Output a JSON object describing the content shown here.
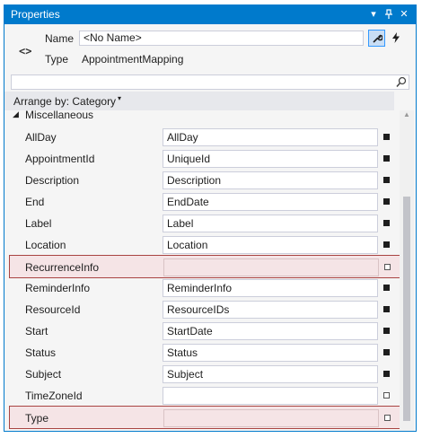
{
  "window": {
    "title": "Properties",
    "buttons": [
      {
        "name": "dropdown-icon",
        "glyph": "▾"
      },
      {
        "name": "pin-icon",
        "glyph": "⊥"
      },
      {
        "name": "close-icon",
        "glyph": "✕"
      }
    ]
  },
  "header": {
    "code_icon": "<>",
    "name_label": "Name",
    "name_value": "<No Name>",
    "type_label": "Type",
    "type_value": "AppointmentMapping",
    "properties_button_icon": "wrench-icon",
    "events_button_icon": "lightning-icon"
  },
  "search": {
    "placeholder": "",
    "icon": "search-icon"
  },
  "arrange": {
    "label": "Arrange by: Category",
    "caret": "▾"
  },
  "grid": {
    "category": {
      "label": "Miscellaneous",
      "arrow": "◢"
    },
    "rows": [
      {
        "name": "AllDay",
        "value": "AllDay",
        "marker": "filled",
        "highlighted": false
      },
      {
        "name": "AppointmentId",
        "value": "UniqueId",
        "marker": "filled",
        "highlighted": false
      },
      {
        "name": "Description",
        "value": "Description",
        "marker": "filled",
        "highlighted": false
      },
      {
        "name": "End",
        "value": "EndDate",
        "marker": "filled",
        "highlighted": false
      },
      {
        "name": "Label",
        "value": "Label",
        "marker": "filled",
        "highlighted": false
      },
      {
        "name": "Location",
        "value": "Location",
        "marker": "filled",
        "highlighted": false
      },
      {
        "name": "RecurrenceInfo",
        "value": "",
        "marker": "empty",
        "highlighted": true
      },
      {
        "name": "ReminderInfo",
        "value": "ReminderInfo",
        "marker": "filled",
        "highlighted": false
      },
      {
        "name": "ResourceId",
        "value": "ResourceIDs",
        "marker": "filled",
        "highlighted": false
      },
      {
        "name": "Start",
        "value": "StartDate",
        "marker": "filled",
        "highlighted": false
      },
      {
        "name": "Status",
        "value": "Status",
        "marker": "filled",
        "highlighted": false
      },
      {
        "name": "Subject",
        "value": "Subject",
        "marker": "filled",
        "highlighted": false
      },
      {
        "name": "TimeZoneId",
        "value": "",
        "marker": "empty",
        "highlighted": false
      },
      {
        "name": "Type",
        "value": "",
        "marker": "empty",
        "highlighted": true
      }
    ]
  },
  "colors": {
    "accent": "#007acc",
    "highlight_border": "#a94442",
    "highlight_fill": "#f5e4e6"
  }
}
